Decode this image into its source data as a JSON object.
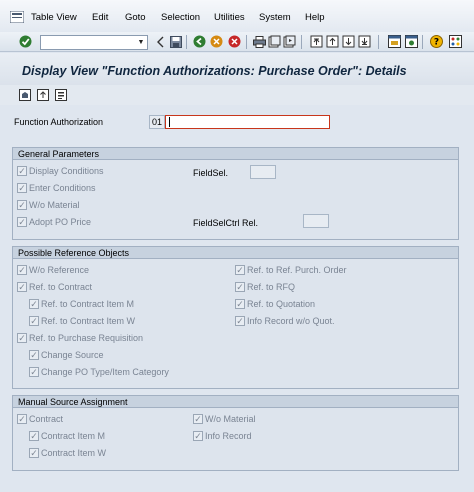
{
  "menu": {
    "items": [
      "Table View",
      "Edit",
      "Goto",
      "Selection",
      "Utilities",
      "System",
      "Help"
    ]
  },
  "toolbar": {
    "command_field_value": ""
  },
  "title": "Display View \"Function Authorizations: Purchase Order\": Details",
  "function_authorization": {
    "label": "Function Authorization",
    "value": "01"
  },
  "general": {
    "title": "General Parameters",
    "display_conditions": "Display Conditions",
    "enter_conditions": "Enter Conditions",
    "wo_material": "W/o Material",
    "adopt_po_price": "Adopt PO Price",
    "fieldsel_label": "FieldSel.",
    "fieldselctrl_label": "FieldSelCtrl Rel."
  },
  "reference": {
    "title": "Possible Reference Objects",
    "wo_reference": "W/o Reference",
    "ref_contract": "Ref. to Contract",
    "ref_contract_item_m": "Ref. to Contract Item M",
    "ref_contract_item_w": "Ref. to Contract Item W",
    "ref_purchase_req": "Ref. to Purchase Requisition",
    "change_source": "Change Source",
    "change_po_type": "Change PO Type/Item Category",
    "ref_purch_order": "Ref. to Ref. Purch. Order",
    "ref_rfq": "Ref. to RFQ",
    "ref_quotation": "Ref. to Quotation",
    "info_record_wo_quot": "Info Record w/o Quot."
  },
  "manual": {
    "title": "Manual Source Assignment",
    "contract": "Contract",
    "contract_item_m": "Contract Item M",
    "contract_item_w": "Contract Item W",
    "wo_material": "W/o Material",
    "info_record": "Info Record"
  },
  "colors": {
    "background": "#dfe6ef",
    "title_text": "#10263f",
    "error_border": "#c8361b"
  }
}
